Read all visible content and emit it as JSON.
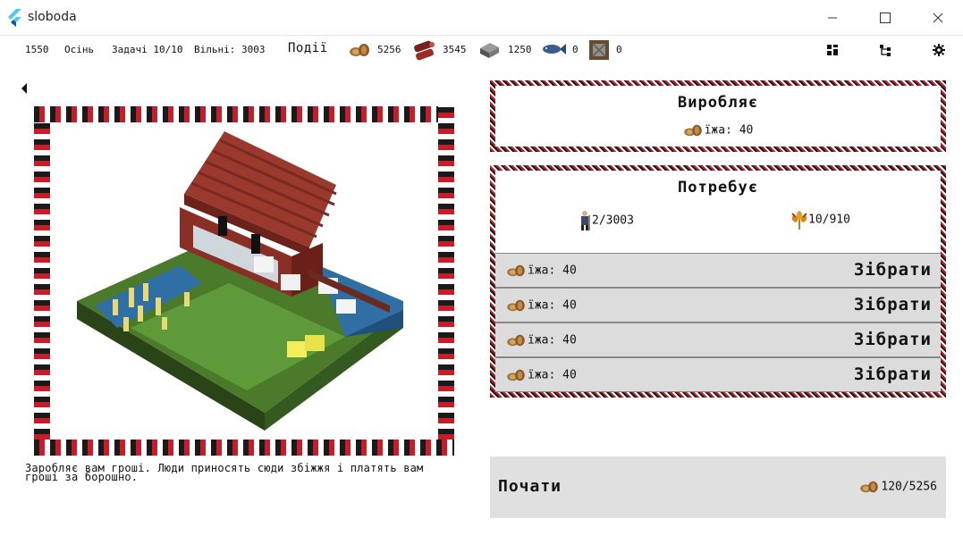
{
  "window": {
    "title": "sloboda",
    "controls": [
      "minimize",
      "maximize",
      "close"
    ]
  },
  "status": {
    "year": "1550",
    "season": "Осінь",
    "tasks": "Задачі 10/10",
    "free": "Вільні: 3003",
    "events": "Події",
    "resources": [
      {
        "name": "food-icon",
        "value": "5256"
      },
      {
        "name": "wood-icon",
        "value": "3545"
      },
      {
        "name": "stone-icon",
        "value": "1250"
      },
      {
        "name": "fish-icon",
        "value": "0"
      },
      {
        "name": "cloth-icon",
        "value": "0"
      }
    ],
    "buttons": [
      "layout-icon",
      "hierarchy-icon",
      "settings-icon"
    ]
  },
  "building": {
    "description": "Заробляє вам гроші. Люди приносять сюди збіжжя і платять вам гроші за борошно."
  },
  "produces": {
    "title": "Виробляє",
    "item": "їжа: 40"
  },
  "requires": {
    "title": "Потребує",
    "workers": "2/3003",
    "tools": "10/910",
    "collect_rows": [
      {
        "label": "їжа: 40",
        "button": "Зібрати"
      },
      {
        "label": "їжа: 40",
        "button": "Зібрати"
      },
      {
        "label": "їжа: 40",
        "button": "Зібрати"
      },
      {
        "label": "їжа: 40",
        "button": "Зібрати"
      }
    ]
  },
  "start": {
    "button": "Почати",
    "cost": "120/5256"
  },
  "colors": {
    "accent_red": "#c41e2a",
    "pattern_black": "#1a1a1a",
    "panel_gray": "#dcdcdc"
  }
}
